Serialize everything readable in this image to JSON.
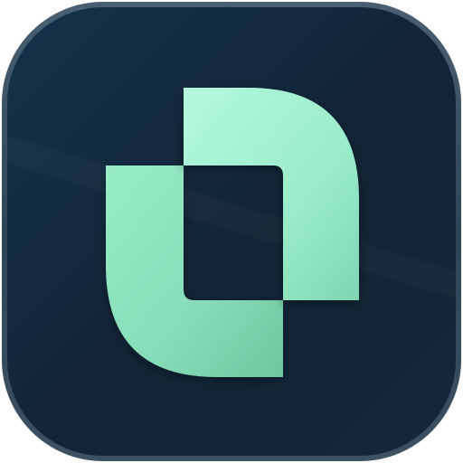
{
  "icon": {
    "name": "app-icon-interlocking-u-shapes",
    "colors": {
      "tile_dark": "#122436",
      "tile_mid": "#14324a",
      "tile_edge": "#2f4556",
      "glyph_light": "#a6f4d6",
      "glyph_mid": "#86dcb8",
      "glyph_dark": "#6fc59f"
    }
  }
}
